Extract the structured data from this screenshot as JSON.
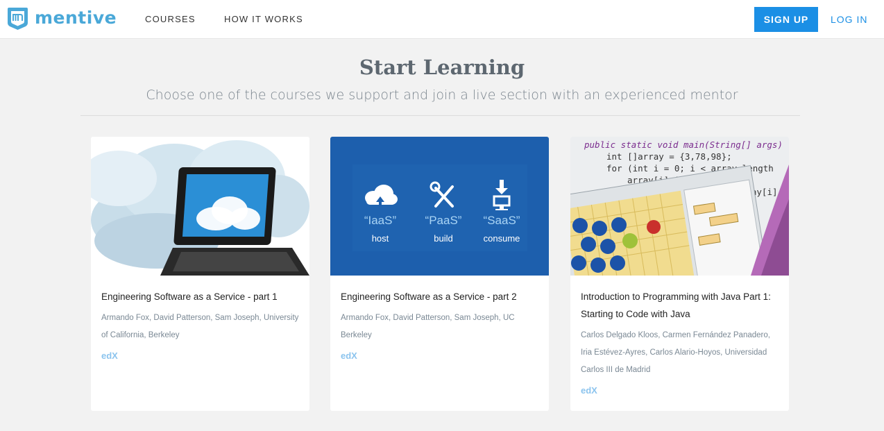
{
  "brand": {
    "name": "mentive",
    "accent": "#4aa8d8",
    "primary": "#1b8fe5"
  },
  "nav": {
    "courses": "COURSES",
    "how_it_works": "HOW IT WORKS",
    "sign_up": "SIGN UP",
    "log_in": "LOG IN"
  },
  "hero": {
    "title": "Start Learning",
    "subtitle": "Choose one of the courses we support and join a live section with an experienced mentor"
  },
  "courses": [
    {
      "title": "Engineering Software as a Service - part 1",
      "authors": "Armando Fox, David Patterson, Sam Joseph, University of California, Berkeley",
      "provider": "edX",
      "image": "cloud-laptop-image"
    },
    {
      "title": "Engineering Software as a Service - part 2",
      "authors": "Armando Fox, David Patterson, Sam Joseph, UC Berkeley",
      "provider": "edX",
      "image": "iaas-paas-saas-image",
      "image_labels": {
        "iaas": "“IaaS”",
        "iaas_sub": "host",
        "paas": "“PaaS”",
        "paas_sub": "build",
        "saas": "“SaaS”",
        "saas_sub": "consume"
      }
    },
    {
      "title": "Introduction to Programming with Java Part 1: Starting to Code with Java",
      "authors": "Carlos Delgado Kloos, Carmen Fernández Panadero, Iria Estévez-Ayres, Carlos Alario-Hoyos, Universidad Carlos III de Madrid",
      "provider": "edX",
      "image": "java-code-image",
      "code_lines": [
        "public static void main(String[] args)",
        "int []array = {3,78,98};",
        "for (int i = 0; i < array.length",
        "array[i]=i*2;",
        "out.println(array[i]"
      ]
    }
  ]
}
